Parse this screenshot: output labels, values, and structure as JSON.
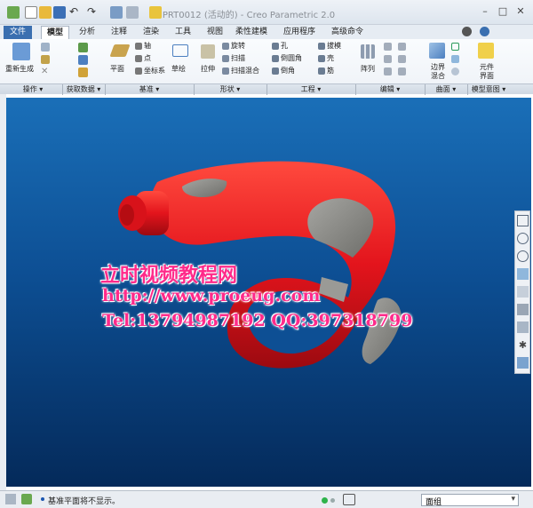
{
  "window": {
    "title": "PRT0012 (活动的) - Creo Parametric 2.0",
    "controls": [
      "–",
      "□",
      "✕"
    ]
  },
  "tabs": [
    "文件",
    "模型",
    "分析",
    "注释",
    "渲染",
    "工具",
    "视图",
    "柔性建模",
    "应用程序",
    "高级命令"
  ],
  "ribbon": {
    "regenerate": "重新生成",
    "plane": "平面",
    "axis": "轴",
    "point": "点",
    "csys": "坐标系",
    "sketch": "草绘",
    "extrude": "拉伸",
    "revolve": "旋转",
    "sweep": "扫描",
    "swept_blend": "扫描混合",
    "hole": "孔",
    "round": "倒圆角",
    "chamfer": "倒角",
    "draft": "拔模",
    "shell": "壳",
    "rib": "筋",
    "pattern": "阵列",
    "boundary_blend_1": "边界",
    "boundary_blend_2": "混合",
    "component_interface_1": "元件",
    "component_interface_2": "界面"
  },
  "groups": [
    "操作 ▾",
    "获取数据 ▾",
    "基准 ▾",
    "形状 ▾",
    "工程 ▾",
    "编辑 ▾",
    "曲面 ▾",
    "模型意图 ▾"
  ],
  "watermark": {
    "line1": "立时视频教程网",
    "line2": "http://www.proeug.com",
    "line3": "Tel:13794987192  QQ:397318799"
  },
  "status": {
    "message": "基准平面将不显示。",
    "filter": "面组"
  },
  "colors": {
    "viewport_top": "#1a6fb8",
    "viewport_bottom": "#042a5a",
    "model_red": "#e3141c",
    "model_grey": "#8a8a86",
    "watermark": "#ff2a8a"
  }
}
